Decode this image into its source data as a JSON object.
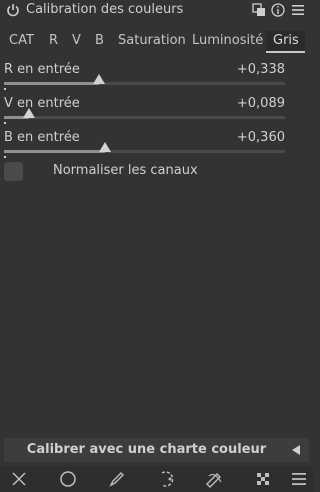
{
  "header": {
    "title": "Calibration des couleurs",
    "icons": [
      "power-icon",
      "presets-icon",
      "reset-icon",
      "menu-icon"
    ]
  },
  "tabs": [
    {
      "label": "CAT",
      "active": false
    },
    {
      "label": "R",
      "active": false
    },
    {
      "label": "V",
      "active": false
    },
    {
      "label": "B",
      "active": false
    },
    {
      "label": "Saturation",
      "active": false
    },
    {
      "label": "Luminosité",
      "active": false
    },
    {
      "label": "Gris",
      "active": true
    }
  ],
  "sliders": [
    {
      "label": "R en entrée",
      "value": "+0,338",
      "level": 0.338
    },
    {
      "label": "V en entrée",
      "value": "+0,089",
      "level": 0.089
    },
    {
      "label": "B en entrée",
      "value": "+0,360",
      "level": 0.36
    }
  ],
  "normalize": {
    "label": "Normaliser les canaux",
    "checked": false
  },
  "calibrate_button": {
    "label": "Calibrer avec une charte couleur"
  },
  "bottom_bar": {
    "icons": [
      "clear-icon",
      "circle-icon",
      "brush-icon",
      "path-icon",
      "draw-icon",
      "checkerboard-icon",
      "hamburger-icon"
    ]
  },
  "colors": {
    "background": "#333333",
    "text": "#cfcfcf",
    "track": "#4a4a4a",
    "fill": "#8f8f8f"
  }
}
